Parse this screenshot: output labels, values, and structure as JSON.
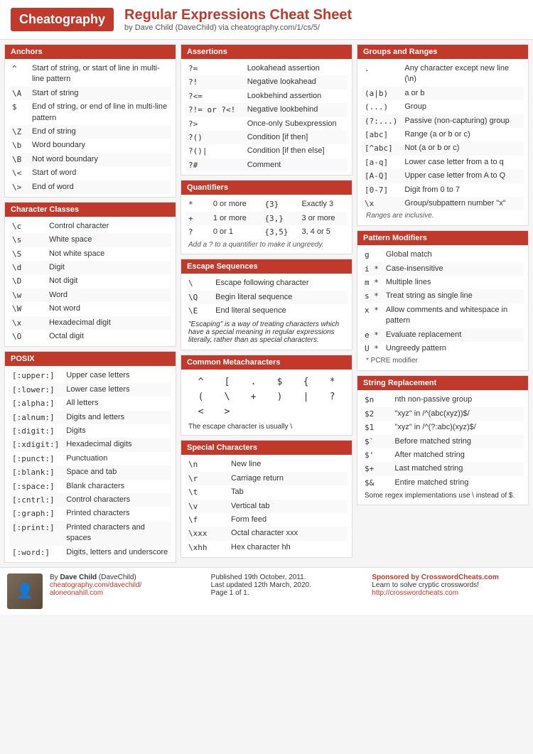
{
  "header": {
    "logo": "Cheatography",
    "title": "Regular Expressions Cheat Sheet",
    "subtitle": "by Dave Child (DaveChild) via cheatography.com/1/cs/5/"
  },
  "anchors": {
    "header": "Anchors",
    "rows": [
      {
        "symbol": "^",
        "desc": "Start of string, or start of line in multi-line pattern"
      },
      {
        "symbol": "\\A",
        "desc": "Start of string"
      },
      {
        "symbol": "$",
        "desc": "End of string, or end of line in multi-line pattern"
      },
      {
        "symbol": "\\Z",
        "desc": "End of string"
      },
      {
        "symbol": "\\b",
        "desc": "Word boundary"
      },
      {
        "symbol": "\\B",
        "desc": "Not word boundary"
      },
      {
        "symbol": "\\<",
        "desc": "Start of word"
      },
      {
        "symbol": "\\>",
        "desc": "End of word"
      }
    ]
  },
  "charclasses": {
    "header": "Character Classes",
    "rows": [
      {
        "symbol": "\\c",
        "desc": "Control character"
      },
      {
        "symbol": "\\s",
        "desc": "White space"
      },
      {
        "symbol": "\\S",
        "desc": "Not white space"
      },
      {
        "symbol": "\\d",
        "desc": "Digit"
      },
      {
        "symbol": "\\D",
        "desc": "Not digit"
      },
      {
        "symbol": "\\w",
        "desc": "Word"
      },
      {
        "symbol": "\\W",
        "desc": "Not word"
      },
      {
        "symbol": "\\x",
        "desc": "Hexadecimal digit"
      },
      {
        "symbol": "\\O",
        "desc": "Octal digit"
      }
    ]
  },
  "posix": {
    "header": "POSIX",
    "rows": [
      {
        "symbol": "[:upper:]",
        "desc": "Upper case letters"
      },
      {
        "symbol": "[:lower:]",
        "desc": "Lower case letters"
      },
      {
        "symbol": "[:alpha:]",
        "desc": "All letters"
      },
      {
        "symbol": "[:alnum:]",
        "desc": "Digits and letters"
      },
      {
        "symbol": "[:digit:]",
        "desc": "Digits"
      },
      {
        "symbol": "[:xdigit:]",
        "desc": "Hexadecimal digits"
      },
      {
        "symbol": "[:punct:]",
        "desc": "Punctuation"
      },
      {
        "symbol": "[:blank:]",
        "desc": "Space and tab"
      },
      {
        "symbol": "[:space:]",
        "desc": "Blank characters"
      },
      {
        "symbol": "[:cntrl:]",
        "desc": "Control characters"
      },
      {
        "symbol": "[:graph:]",
        "desc": "Printed characters"
      },
      {
        "symbol": "[:print:]",
        "desc": "Printed characters and spaces"
      },
      {
        "symbol": "[:word:]",
        "desc": "Digits, letters and underscore"
      }
    ]
  },
  "assertions": {
    "header": "Assertions",
    "rows": [
      {
        "symbol": "?=",
        "desc": "Lookahead assertion"
      },
      {
        "symbol": "?!",
        "desc": "Negative lookahead"
      },
      {
        "symbol": "?<=",
        "desc": "Lookbehind assertion"
      },
      {
        "symbol": "?!= or ?<!",
        "desc": "Negative lookbehind"
      },
      {
        "symbol": "?>",
        "desc": "Once-only Subexpression"
      },
      {
        "symbol": "?()",
        "desc": "Condition [if then]"
      },
      {
        "symbol": "?()|",
        "desc": "Condition [if then else]"
      },
      {
        "symbol": "?#",
        "desc": "Comment"
      }
    ]
  },
  "quantifiers": {
    "header": "Quantifiers",
    "rows": [
      {
        "symbol": "*",
        "desc": "0 or more",
        "sym2": "{3}",
        "desc2": "Exactly 3"
      },
      {
        "symbol": "+",
        "desc": "1 or more",
        "sym2": "{3,}",
        "desc2": "3 or more"
      },
      {
        "symbol": "?",
        "desc": "0 or 1",
        "sym2": "{3,5}",
        "desc2": "3, 4 or 5"
      }
    ],
    "note": "Add a ? to a quantifier to make it ungreedy."
  },
  "escape": {
    "header": "Escape Sequences",
    "rows": [
      {
        "symbol": "\\",
        "desc": "Escape following character"
      },
      {
        "symbol": "\\Q",
        "desc": "Begin literal sequence"
      },
      {
        "symbol": "\\E",
        "desc": "End literal sequence"
      }
    ],
    "note": "\"Escaping\" is a way of treating characters which have a special meaning in regular expressions literally, rather than as special characters."
  },
  "metachar": {
    "header": "Common Metacharacters",
    "chars": [
      "^",
      "[",
      ".",
      "$",
      "{",
      "*",
      "(",
      "\\",
      "+",
      ")",
      "|",
      "?",
      "<",
      ">"
    ],
    "note": "The escape character is usually \\"
  },
  "special": {
    "header": "Special Characters",
    "rows": [
      {
        "symbol": "\\n",
        "desc": "New line"
      },
      {
        "symbol": "\\r",
        "desc": "Carriage return"
      },
      {
        "symbol": "\\t",
        "desc": "Tab"
      },
      {
        "symbol": "\\v",
        "desc": "Vertical tab"
      },
      {
        "symbol": "\\f",
        "desc": "Form feed"
      },
      {
        "symbol": "\\xxx",
        "desc": "Octal character xxx"
      },
      {
        "symbol": "\\xhh",
        "desc": "Hex character hh"
      }
    ]
  },
  "groups": {
    "header": "Groups and Ranges",
    "rows": [
      {
        "symbol": ".",
        "desc": "Any character except new line (\\n)"
      },
      {
        "symbol": "(a|b)",
        "desc": "a or b"
      },
      {
        "symbol": "(...)",
        "desc": "Group"
      },
      {
        "symbol": "(?:...)",
        "desc": "Passive (non-capturing) group"
      },
      {
        "symbol": "[abc]",
        "desc": "Range (a or b or c)"
      },
      {
        "symbol": "[^abc]",
        "desc": "Not (a or b or c)"
      },
      {
        "symbol": "[a-q]",
        "desc": "Lower case letter from a to q"
      },
      {
        "symbol": "[A-Q]",
        "desc": "Upper case letter from A to Q"
      },
      {
        "symbol": "[0-7]",
        "desc": "Digit from 0 to 7"
      },
      {
        "symbol": "\\x",
        "desc": "Group/subpattern number \"x\""
      }
    ],
    "note": "Ranges are inclusive."
  },
  "patternmod": {
    "header": "Pattern Modifiers",
    "rows": [
      {
        "symbol": "g",
        "desc": "Global match"
      },
      {
        "symbol": "i *",
        "desc": "Case-insensitive"
      },
      {
        "symbol": "m *",
        "desc": "Multiple lines"
      },
      {
        "symbol": "s *",
        "desc": "Treat string as single line"
      },
      {
        "symbol": "x *",
        "desc": "Allow comments and whitespace in pattern"
      },
      {
        "symbol": "e *",
        "desc": "Evaluate replacement"
      },
      {
        "symbol": "U *",
        "desc": "Ungreedy pattern"
      }
    ],
    "note": "* PCRE modifier"
  },
  "stringrep": {
    "header": "String Replacement",
    "rows": [
      {
        "symbol": "$n",
        "desc": "nth non-passive group"
      },
      {
        "symbol": "$2",
        "desc": "\"xyz\" in /^(abc(xyz))$/"
      },
      {
        "symbol": "$1",
        "desc": "\"xyz\" in /^(?:abc)(xyz)$/"
      },
      {
        "symbol": "$`",
        "desc": "Before matched string"
      },
      {
        "symbol": "$'",
        "desc": "After matched string"
      },
      {
        "symbol": "$+",
        "desc": "Last matched string"
      },
      {
        "symbol": "$&",
        "desc": "Entire matched string"
      }
    ],
    "note": "Some regex implementations use \\ instead of $."
  },
  "footer": {
    "author": "Dave Child",
    "author_handle": "DaveChild",
    "links": [
      "cheatography.com/davechild/",
      "aloneonahill.com"
    ],
    "published": "Published 19th October, 2011.",
    "updated": "Last updated 12th March, 2020.",
    "page": "Page 1 of 1.",
    "sponsor_text": "Sponsored by CrosswordCheats.com",
    "sponsor_desc": "Learn to solve cryptic crosswords!",
    "sponsor_link": "http://crosswordcheats.com"
  }
}
